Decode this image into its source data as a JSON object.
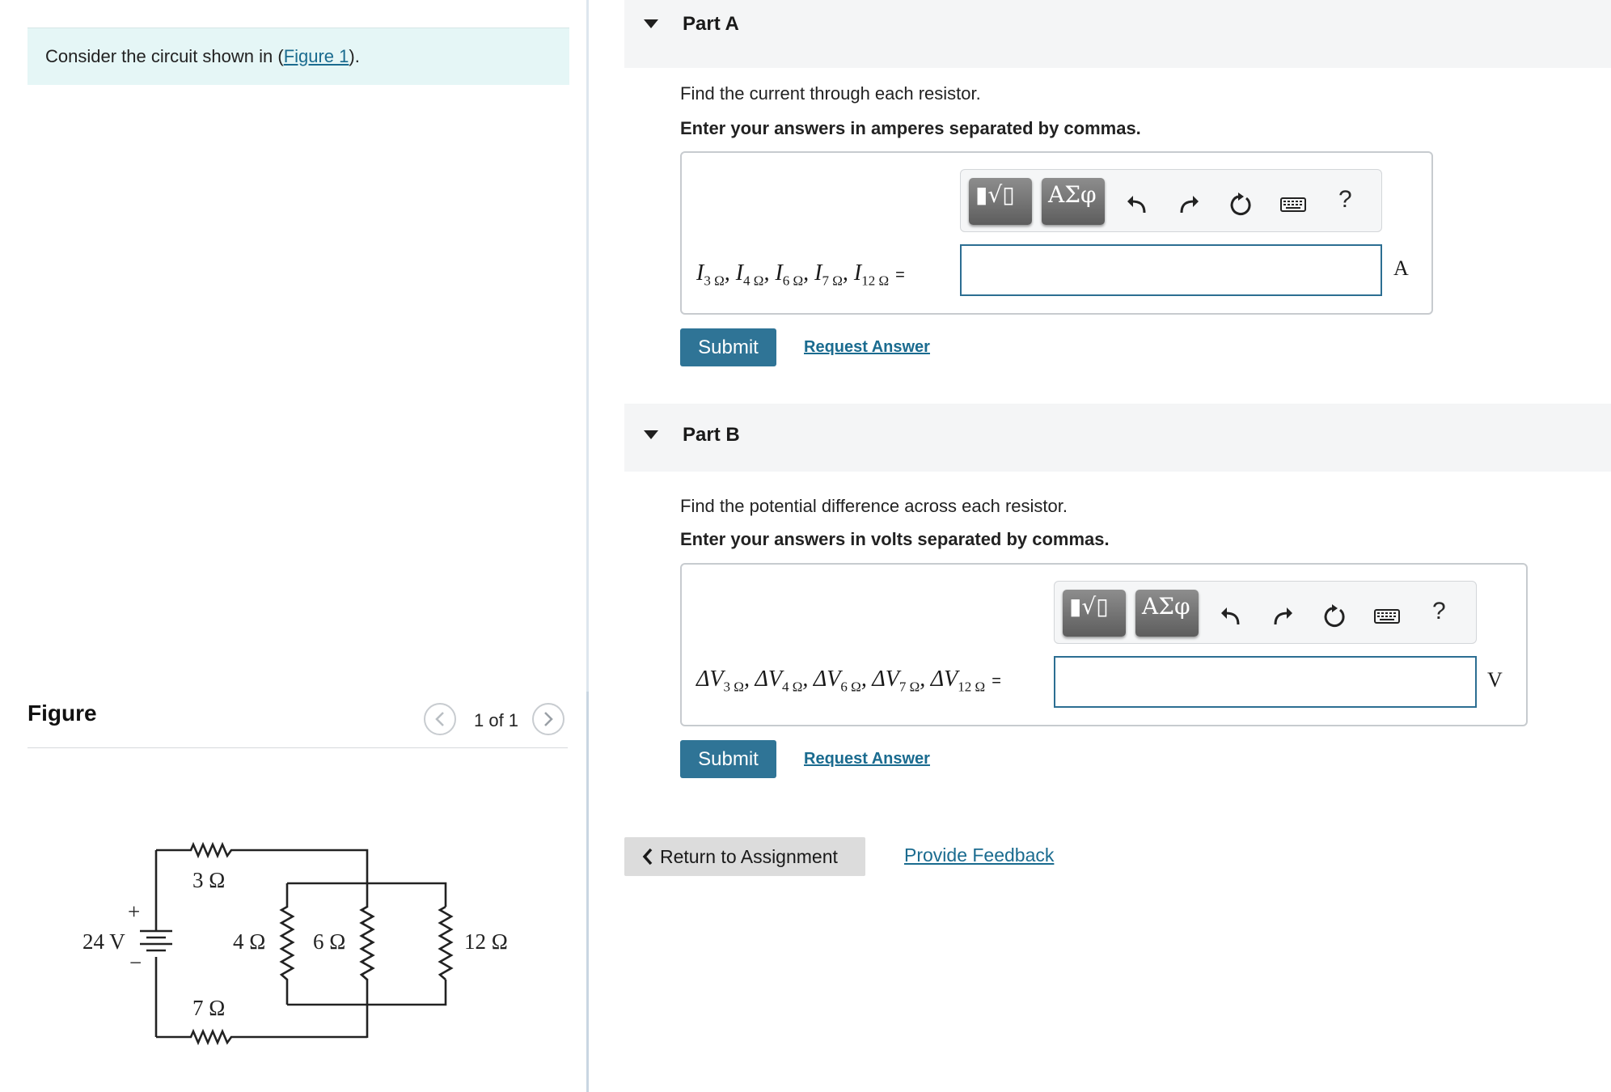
{
  "intro": {
    "text_before": "Consider the circuit shown in (",
    "figure_link": "Figure 1",
    "text_after": ")."
  },
  "figure": {
    "title": "Figure",
    "pager": "1 of 1",
    "circuit_labels": {
      "battery": "24 V",
      "plus": "+",
      "minus": "−",
      "r3": "3 Ω",
      "r4": "4 Ω",
      "r6": "6 Ω",
      "r7": "7 Ω",
      "r12": "12 Ω"
    }
  },
  "parts": [
    {
      "title": "Part A",
      "question": "Find the current through each resistor.",
      "instruction": "Enter your answers in amperes separated by commas.",
      "equation": {
        "var": "I",
        "subs": [
          "3 Ω",
          "4 Ω",
          "6 Ω",
          "7 Ω",
          "12 Ω"
        ],
        "equals": "="
      },
      "answer_value": "",
      "unit": "A",
      "submit_label": "Submit",
      "request_label": "Request Answer"
    },
    {
      "title": "Part B",
      "question": "Find the potential difference across each resistor.",
      "instruction": "Enter your answers in volts separated by commas.",
      "equation": {
        "var": "ΔV",
        "subs": [
          "3 Ω",
          "4 Ω",
          "6 Ω",
          "7 Ω",
          "12 Ω"
        ],
        "equals": "="
      },
      "answer_value": "",
      "unit": "V",
      "submit_label": "Submit",
      "request_label": "Request Answer"
    }
  ],
  "toolbar": {
    "template_symbol": "▮√▯",
    "greek_symbol": "ΑΣφ",
    "help_symbol": "?",
    "icons": [
      "templates-icon",
      "greek-symbols-icon",
      "undo-icon",
      "redo-icon",
      "reset-icon",
      "keyboard-icon",
      "help-icon"
    ]
  },
  "footer": {
    "return_label": "Return to Assignment",
    "feedback_label": "Provide Feedback"
  },
  "colors": {
    "accent": "#2f7496",
    "link": "#1a6b8f",
    "intro_bg": "#e5f6f6",
    "part_header_bg": "#f4f5f6"
  }
}
